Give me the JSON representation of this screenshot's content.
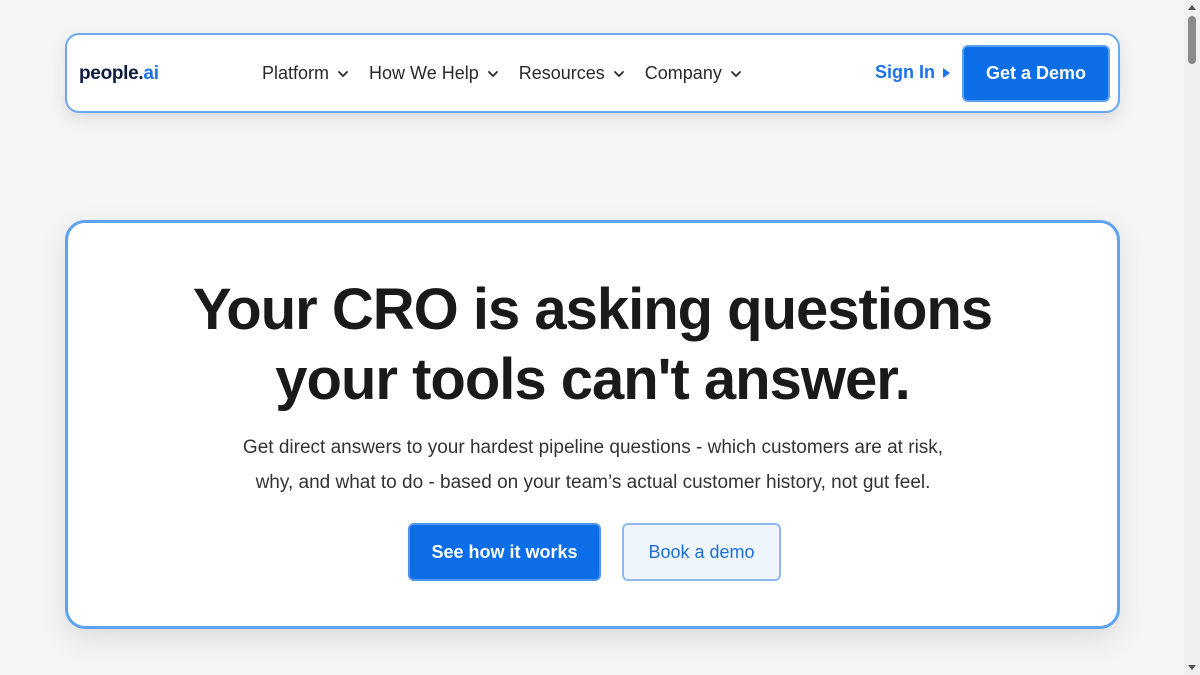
{
  "nav": {
    "logo_main": "people.",
    "logo_ai": "ai",
    "items": [
      {
        "label": "Platform",
        "icon": "chevron-down-icon"
      },
      {
        "label": "How We Help",
        "icon": "chevron-down-icon"
      },
      {
        "label": "Resources",
        "icon": "chevron-down-icon"
      },
      {
        "label": "Company",
        "icon": "chevron-down-icon"
      }
    ],
    "sign_in": "Sign In",
    "get_demo": "Get a Demo"
  },
  "hero": {
    "title_line1": "Your CRO is asking questions",
    "title_line2": "your tools can't answer.",
    "subtitle_line1": "Get direct answers to your hardest pipeline questions - which customers are at risk,",
    "subtitle_line2": "why, and what to do - based on your team’s actual customer history, not gut feel.",
    "primary_cta": "See how it works",
    "secondary_cta": "Book a demo"
  },
  "colors": {
    "accent": "#0b6ee6",
    "border": "#5ea3f0",
    "background": "#f5f5f5"
  }
}
